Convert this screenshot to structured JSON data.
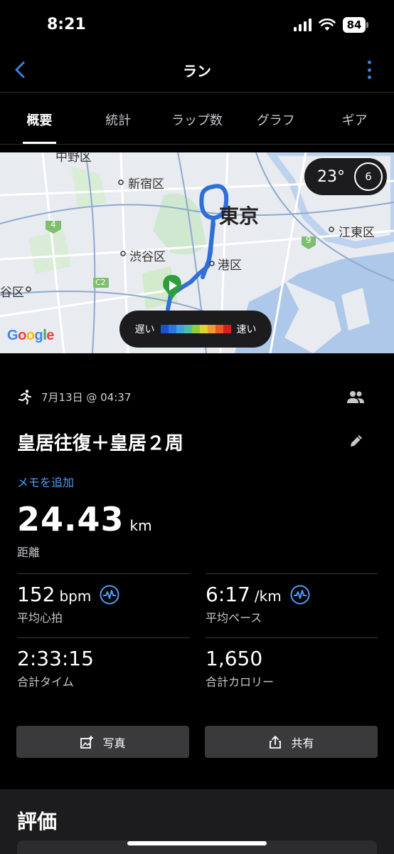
{
  "status_bar": {
    "time": "8:21",
    "battery": "84"
  },
  "header": {
    "title": "ラン"
  },
  "tabs": [
    {
      "label": "概要",
      "active": true
    },
    {
      "label": "統計"
    },
    {
      "label": "ラップ数"
    },
    {
      "label": "グラフ"
    },
    {
      "label": "ギア"
    }
  ],
  "map": {
    "labels": {
      "shinjuku": "新宿区",
      "tokyo": "東京",
      "koto": "江東区",
      "shibuya": "渋谷区",
      "minato": "港区",
      "ward_partial": "谷区",
      "top_partial": "中野区",
      "route_4": "4",
      "route_9": "9",
      "route_c2": "C2"
    },
    "temperature": "23°",
    "wind": "6",
    "legend": {
      "slow": "遅い",
      "fast": "速い",
      "colors": [
        "#1f4fd1",
        "#2b78e4",
        "#3ea0e6",
        "#4cbfa8",
        "#8fcf3c",
        "#e0d234",
        "#f29a2e",
        "#ea5a23",
        "#d61f1f"
      ]
    },
    "attribution": "Google"
  },
  "activity": {
    "date": "7月13日 @ 04:37",
    "title": "皇居往復＋皇居２周",
    "add_memo": "メモを追加",
    "distance": {
      "value": "24.43",
      "unit": "km",
      "label": "距離"
    },
    "stats": {
      "heart_rate": {
        "value": "152",
        "unit": "bpm",
        "label": "平均心拍"
      },
      "pace": {
        "value": "6:17",
        "unit": "/km",
        "label": "平均ペース"
      },
      "time": {
        "value": "2:33:15",
        "label": "合計タイム"
      },
      "calories": {
        "value": "1,650",
        "label": "合計カロリー"
      }
    }
  },
  "actions": {
    "photo": "写真",
    "share": "共有"
  },
  "rating": {
    "title": "評価"
  },
  "colors": {
    "accent": "#4f9cf5",
    "route": "#2f6fd6",
    "start": "#2e9e3b"
  }
}
